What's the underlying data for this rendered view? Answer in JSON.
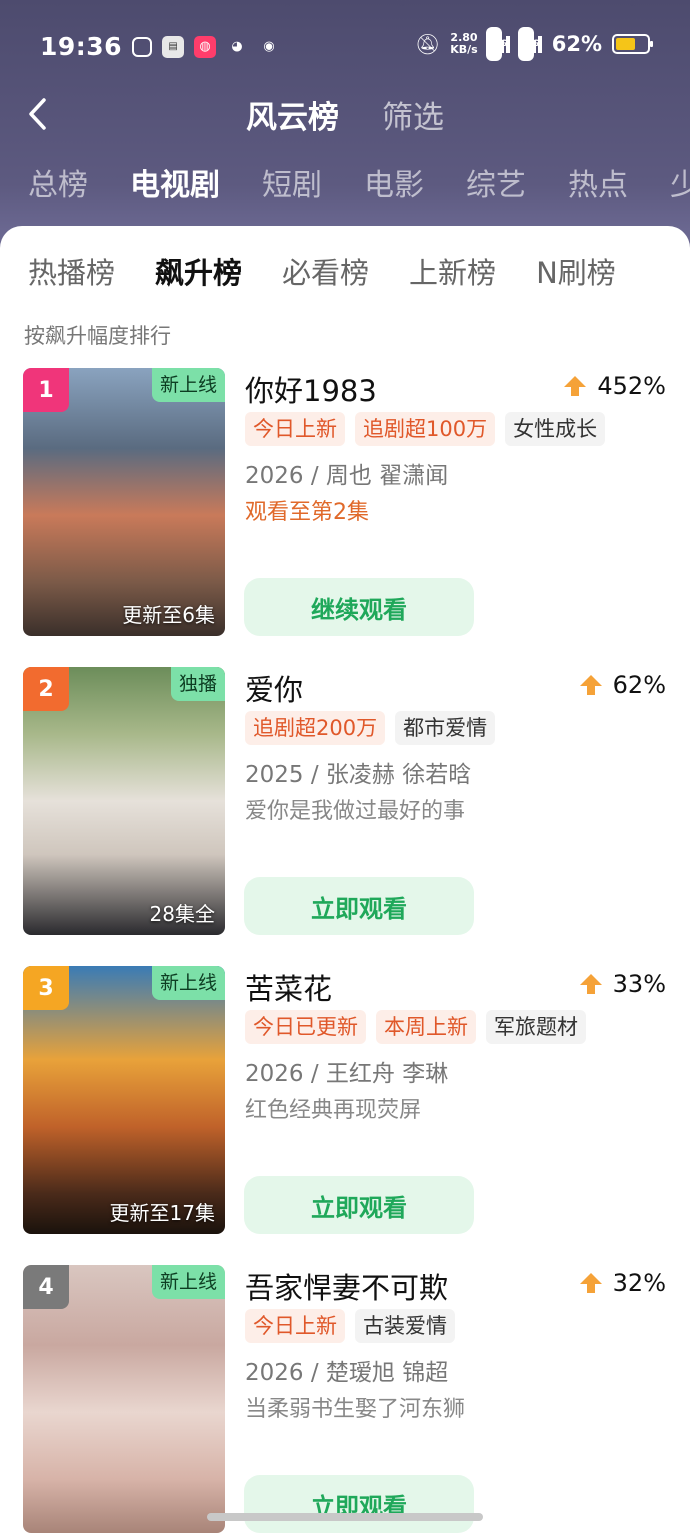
{
  "status_bar": {
    "time": "19:36",
    "net_speed_value": "2.80",
    "net_speed_unit": "KB/s",
    "signal1": "5G",
    "signal2": "5G",
    "battery": "62%",
    "battery_level": 0.62
  },
  "header": {
    "title": "风云榜",
    "filter": "筛选"
  },
  "category_tabs": [
    "总榜",
    "电视剧",
    "短剧",
    "电影",
    "综艺",
    "热点",
    "少"
  ],
  "category_active_index": 1,
  "sub_tabs": [
    "热播榜",
    "飙升榜",
    "必看榜",
    "上新榜",
    "N刷榜"
  ],
  "sub_active_index": 1,
  "sort_hint": "按飙升幅度排行",
  "items": [
    {
      "rank": "1",
      "rank_color": "#f0357a",
      "corner_badge": "新上线",
      "poster_caption": "更新至6集",
      "title": "你好1983",
      "trend": "452%",
      "tags": [
        {
          "text": "今日上新",
          "style": "hot"
        },
        {
          "text": "追剧超100万",
          "style": "hot"
        },
        {
          "text": "女性成长",
          "style": "plain"
        }
      ],
      "meta": "2026 / 周也  翟潇闻",
      "desc": "观看至第2集",
      "desc_style": "orange",
      "button": "继续观看"
    },
    {
      "rank": "2",
      "rank_color": "#f26b2f",
      "corner_badge": "独播",
      "poster_caption": "28集全",
      "title": "爱你",
      "trend": "62%",
      "tags": [
        {
          "text": "追剧超200万",
          "style": "hot"
        },
        {
          "text": "都市爱情",
          "style": "plain"
        }
      ],
      "meta": "2025 / 张凌赫  徐若晗",
      "desc": "爱你是我做过最好的事",
      "desc_style": "gray",
      "button": "立即观看"
    },
    {
      "rank": "3",
      "rank_color": "#f5a623",
      "corner_badge": "新上线",
      "poster_caption": "更新至17集",
      "title": "苦菜花",
      "trend": "33%",
      "tags": [
        {
          "text": "今日已更新",
          "style": "hot"
        },
        {
          "text": "本周上新",
          "style": "hot"
        },
        {
          "text": "军旅题材",
          "style": "plain"
        }
      ],
      "meta": "2026 / 王红舟  李琳",
      "desc": "红色经典再现荧屏",
      "desc_style": "gray",
      "button": "立即观看"
    },
    {
      "rank": "4",
      "rank_color": "#7a7a7a",
      "corner_badge": "新上线",
      "poster_caption": "",
      "title": "吾家悍妻不可欺",
      "trend": "32%",
      "tags": [
        {
          "text": "今日上新",
          "style": "hot"
        },
        {
          "text": "古装爱情",
          "style": "plain"
        }
      ],
      "meta": "2026 / 楚瑷旭  锦超",
      "desc": "当柔弱书生娶了河东狮",
      "desc_style": "gray",
      "button": "立即观看"
    }
  ]
}
